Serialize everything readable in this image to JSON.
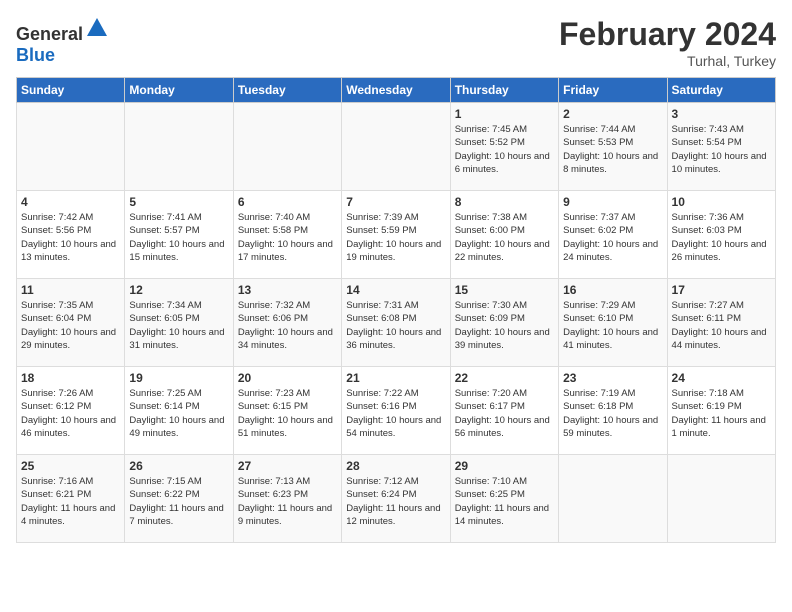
{
  "header": {
    "logo_general": "General",
    "logo_blue": "Blue",
    "title": "February 2024",
    "location": "Turhal, Turkey"
  },
  "days_of_week": [
    "Sunday",
    "Monday",
    "Tuesday",
    "Wednesday",
    "Thursday",
    "Friday",
    "Saturday"
  ],
  "weeks": [
    [
      {
        "day": "",
        "info": ""
      },
      {
        "day": "",
        "info": ""
      },
      {
        "day": "",
        "info": ""
      },
      {
        "day": "",
        "info": ""
      },
      {
        "day": "1",
        "info": "Sunrise: 7:45 AM\nSunset: 5:52 PM\nDaylight: 10 hours\nand 6 minutes."
      },
      {
        "day": "2",
        "info": "Sunrise: 7:44 AM\nSunset: 5:53 PM\nDaylight: 10 hours\nand 8 minutes."
      },
      {
        "day": "3",
        "info": "Sunrise: 7:43 AM\nSunset: 5:54 PM\nDaylight: 10 hours\nand 10 minutes."
      }
    ],
    [
      {
        "day": "4",
        "info": "Sunrise: 7:42 AM\nSunset: 5:56 PM\nDaylight: 10 hours\nand 13 minutes."
      },
      {
        "day": "5",
        "info": "Sunrise: 7:41 AM\nSunset: 5:57 PM\nDaylight: 10 hours\nand 15 minutes."
      },
      {
        "day": "6",
        "info": "Sunrise: 7:40 AM\nSunset: 5:58 PM\nDaylight: 10 hours\nand 17 minutes."
      },
      {
        "day": "7",
        "info": "Sunrise: 7:39 AM\nSunset: 5:59 PM\nDaylight: 10 hours\nand 19 minutes."
      },
      {
        "day": "8",
        "info": "Sunrise: 7:38 AM\nSunset: 6:00 PM\nDaylight: 10 hours\nand 22 minutes."
      },
      {
        "day": "9",
        "info": "Sunrise: 7:37 AM\nSunset: 6:02 PM\nDaylight: 10 hours\nand 24 minutes."
      },
      {
        "day": "10",
        "info": "Sunrise: 7:36 AM\nSunset: 6:03 PM\nDaylight: 10 hours\nand 26 minutes."
      }
    ],
    [
      {
        "day": "11",
        "info": "Sunrise: 7:35 AM\nSunset: 6:04 PM\nDaylight: 10 hours\nand 29 minutes."
      },
      {
        "day": "12",
        "info": "Sunrise: 7:34 AM\nSunset: 6:05 PM\nDaylight: 10 hours\nand 31 minutes."
      },
      {
        "day": "13",
        "info": "Sunrise: 7:32 AM\nSunset: 6:06 PM\nDaylight: 10 hours\nand 34 minutes."
      },
      {
        "day": "14",
        "info": "Sunrise: 7:31 AM\nSunset: 6:08 PM\nDaylight: 10 hours\nand 36 minutes."
      },
      {
        "day": "15",
        "info": "Sunrise: 7:30 AM\nSunset: 6:09 PM\nDaylight: 10 hours\nand 39 minutes."
      },
      {
        "day": "16",
        "info": "Sunrise: 7:29 AM\nSunset: 6:10 PM\nDaylight: 10 hours\nand 41 minutes."
      },
      {
        "day": "17",
        "info": "Sunrise: 7:27 AM\nSunset: 6:11 PM\nDaylight: 10 hours\nand 44 minutes."
      }
    ],
    [
      {
        "day": "18",
        "info": "Sunrise: 7:26 AM\nSunset: 6:12 PM\nDaylight: 10 hours\nand 46 minutes."
      },
      {
        "day": "19",
        "info": "Sunrise: 7:25 AM\nSunset: 6:14 PM\nDaylight: 10 hours\nand 49 minutes."
      },
      {
        "day": "20",
        "info": "Sunrise: 7:23 AM\nSunset: 6:15 PM\nDaylight: 10 hours\nand 51 minutes."
      },
      {
        "day": "21",
        "info": "Sunrise: 7:22 AM\nSunset: 6:16 PM\nDaylight: 10 hours\nand 54 minutes."
      },
      {
        "day": "22",
        "info": "Sunrise: 7:20 AM\nSunset: 6:17 PM\nDaylight: 10 hours\nand 56 minutes."
      },
      {
        "day": "23",
        "info": "Sunrise: 7:19 AM\nSunset: 6:18 PM\nDaylight: 10 hours\nand 59 minutes."
      },
      {
        "day": "24",
        "info": "Sunrise: 7:18 AM\nSunset: 6:19 PM\nDaylight: 11 hours\nand 1 minute."
      }
    ],
    [
      {
        "day": "25",
        "info": "Sunrise: 7:16 AM\nSunset: 6:21 PM\nDaylight: 11 hours\nand 4 minutes."
      },
      {
        "day": "26",
        "info": "Sunrise: 7:15 AM\nSunset: 6:22 PM\nDaylight: 11 hours\nand 7 minutes."
      },
      {
        "day": "27",
        "info": "Sunrise: 7:13 AM\nSunset: 6:23 PM\nDaylight: 11 hours\nand 9 minutes."
      },
      {
        "day": "28",
        "info": "Sunrise: 7:12 AM\nSunset: 6:24 PM\nDaylight: 11 hours\nand 12 minutes."
      },
      {
        "day": "29",
        "info": "Sunrise: 7:10 AM\nSunset: 6:25 PM\nDaylight: 11 hours\nand 14 minutes."
      },
      {
        "day": "",
        "info": ""
      },
      {
        "day": "",
        "info": ""
      }
    ]
  ]
}
